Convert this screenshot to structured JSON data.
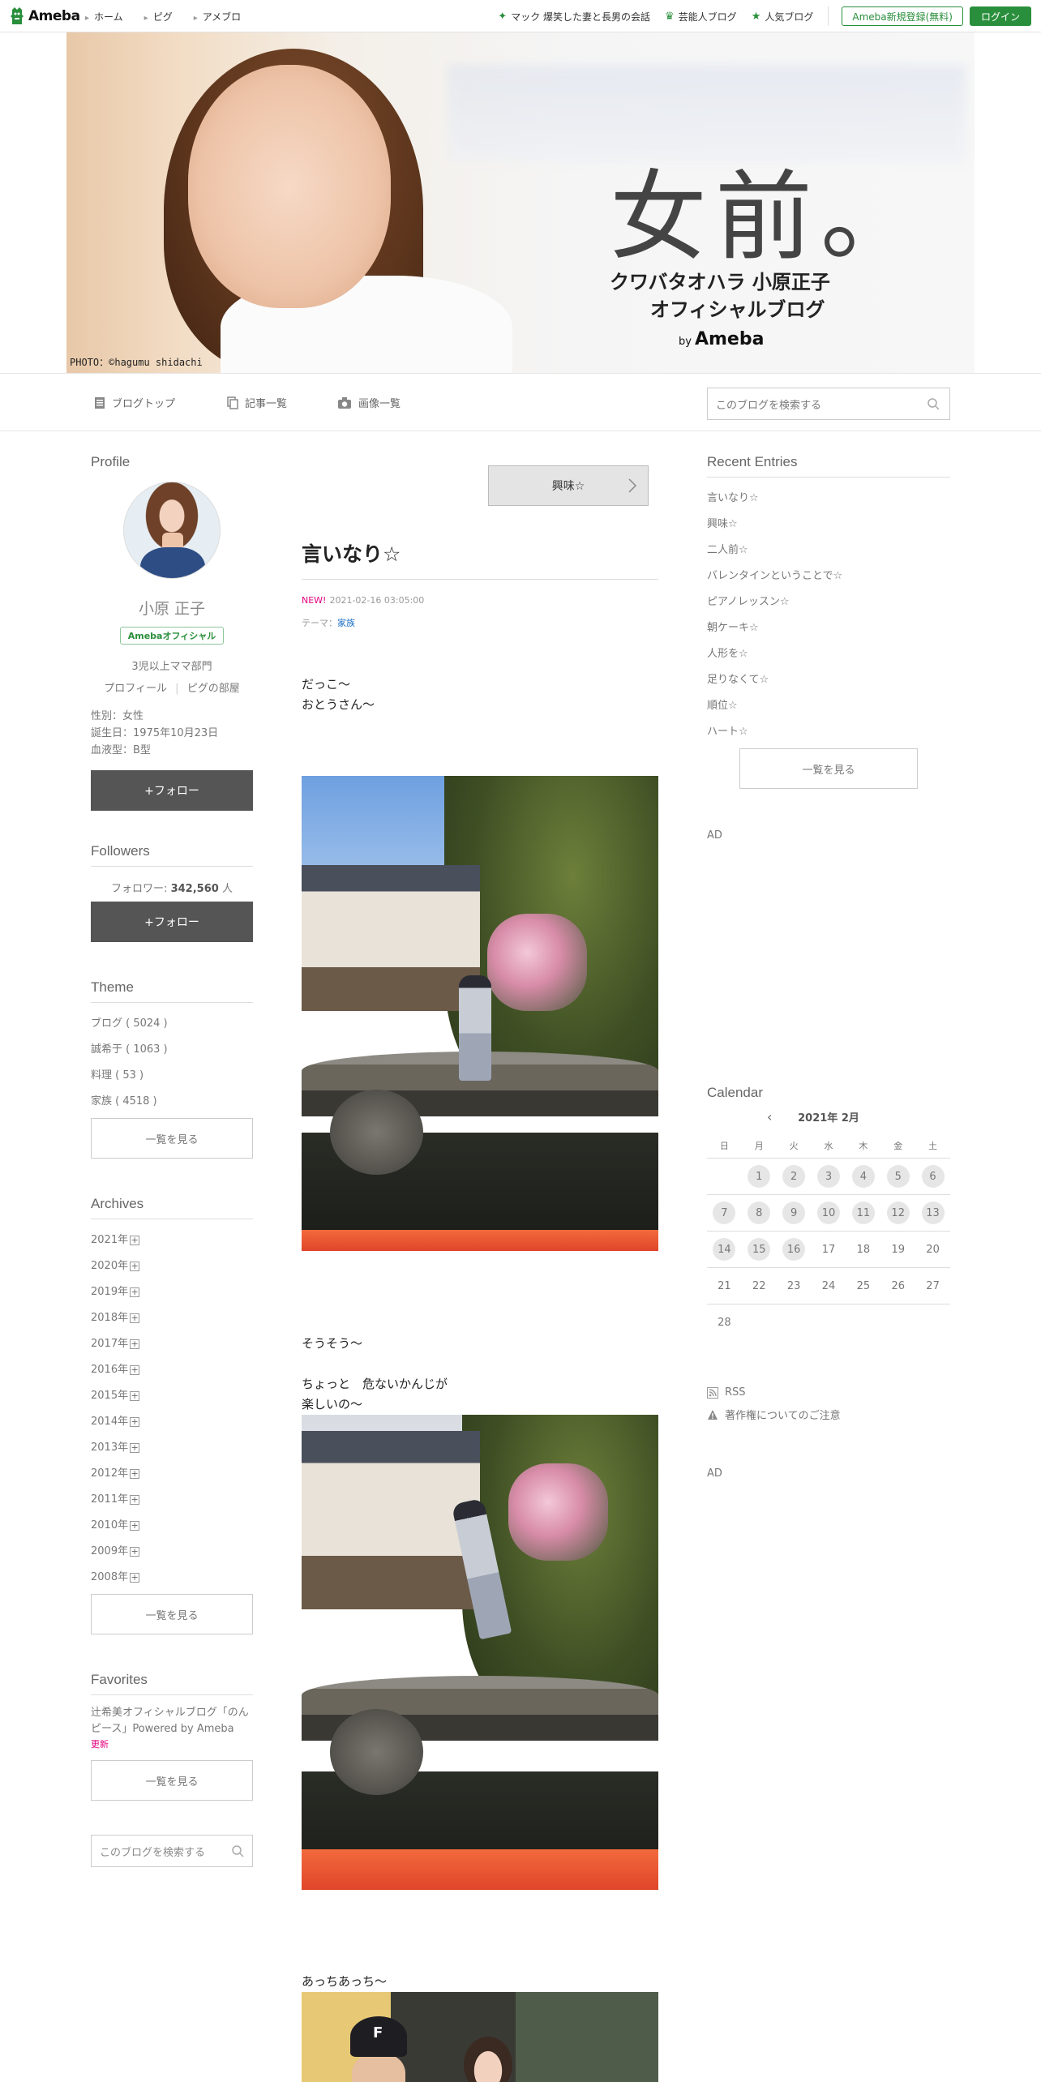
{
  "header": {
    "logo": "Ameba",
    "nav": [
      "ホーム",
      "ピグ",
      "アメブロ"
    ],
    "links": [
      "マック 爆笑した妻と長男の会話",
      "芸能人ブログ",
      "人気ブログ"
    ],
    "register": "Ameba新規登録(無料)",
    "login": "ログイン"
  },
  "banner": {
    "title": "女前。",
    "sub1": "クワバタオハラ 小原正子",
    "sub2": "オフィシャルブログ",
    "by": "by",
    "by_brand": "Ameba",
    "credit": "PHOTO：©hagumu shidachi"
  },
  "blognav": {
    "top": "ブログトップ",
    "entries": "記事一覧",
    "images": "画像一覧",
    "search_placeholder": "このブログを検索する"
  },
  "profile": {
    "title": "Profile",
    "name": "小原 正子",
    "badge": "Ameba",
    "badge_suffix": "オフィシャル",
    "tagline": "3児以上ママ部門",
    "links": [
      "プロフィール",
      "ピグの部屋"
    ],
    "gender": "性別：女性",
    "birthday": "誕生日：1975年10月23日",
    "blood": "血液型：B型",
    "follow": "+フォロー"
  },
  "followers": {
    "title": "Followers",
    "label": "フォロワー:",
    "count": "342,560",
    "unit": "人",
    "follow": "+フォロー"
  },
  "theme": {
    "title": "Theme",
    "items": [
      "ブログ ( 5024 )",
      "誠希于 ( 1063 )",
      "料理 ( 53 )",
      "家族 ( 4518 )"
    ],
    "more": "一覧を見る"
  },
  "archives": {
    "title": "Archives",
    "years": [
      "2021年",
      "2020年",
      "2019年",
      "2018年",
      "2017年",
      "2016年",
      "2015年",
      "2014年",
      "2013年",
      "2012年",
      "2011年",
      "2010年",
      "2009年",
      "2008年"
    ],
    "plus": "+",
    "more": "一覧を見る"
  },
  "favorites": {
    "title": "Favorites",
    "item": "辻希美オフィシャルブログ「のんピース」Powered by Ameba",
    "updated": "更新",
    "more": "一覧を見る",
    "search_placeholder": "このブログを検索する"
  },
  "entry": {
    "prev_label": "興味☆",
    "title": "言いなり☆",
    "new": "NEW!",
    "date": "2021-02-16 03:05:00",
    "theme_label": "テーマ：",
    "theme": "家族",
    "text1a": "だっこ～",
    "text1b": "おとうさん～",
    "text2": "そうそう～",
    "text3a": "ちょっと　危ないかんじが",
    "text3b": "楽しいの～",
    "text4": "あっちあっち～",
    "cap_letter": "F"
  },
  "recent": {
    "title": "Recent Entries",
    "items": [
      "言いなり☆",
      "興味☆",
      "二人前☆",
      "バレンタインということで☆",
      "ピアノレッスン☆",
      "朝ケーキ☆",
      "人形を☆",
      "足りなくて☆",
      "順位☆",
      "ハート☆"
    ],
    "more": "一覧を見る"
  },
  "ads": {
    "ad1": "AD",
    "ad2": "AD"
  },
  "calendar": {
    "title": "Calendar",
    "month": "2021年 2月",
    "prev": "‹",
    "dow": [
      "日",
      "月",
      "火",
      "水",
      "木",
      "金",
      "土"
    ],
    "weeks": [
      [
        "",
        "1",
        "2",
        "3",
        "4",
        "5",
        "6"
      ],
      [
        "7",
        "8",
        "9",
        "10",
        "11",
        "12",
        "13"
      ],
      [
        "14",
        "15",
        "16",
        "17",
        "18",
        "19",
        "20"
      ],
      [
        "21",
        "22",
        "23",
        "24",
        "25",
        "26",
        "27"
      ],
      [
        "28",
        "",
        "",
        "",
        "",
        "",
        ""
      ]
    ],
    "posted_days": [
      "1",
      "2",
      "3",
      "4",
      "5",
      "6",
      "7",
      "8",
      "9",
      "10",
      "11",
      "12",
      "13",
      "14",
      "15",
      "16"
    ]
  },
  "footer_links": {
    "rss": "RSS",
    "copyright": "著作権についてのご注意"
  },
  "colors": {
    "brand": "#2a8f3c",
    "new": "#e4007f",
    "link": "#1a6fc4",
    "follow": "#555555"
  }
}
